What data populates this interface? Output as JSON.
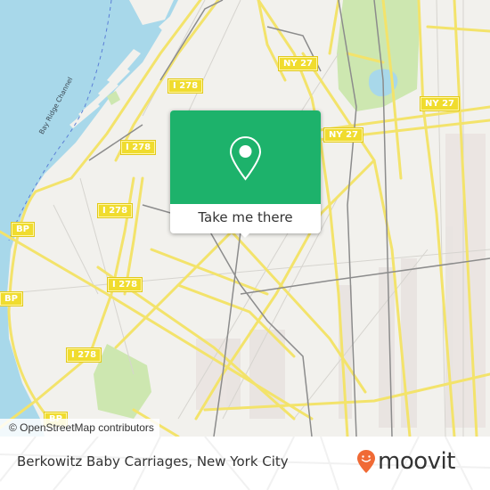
{
  "map": {
    "water_label": "Bay Ridge Channel",
    "road_shields": [
      {
        "label": "I 278",
        "route": "interstate"
      },
      {
        "label": "I 278",
        "route": "interstate"
      },
      {
        "label": "I 278",
        "route": "interstate"
      },
      {
        "label": "I 278",
        "route": "interstate"
      },
      {
        "label": "I 278",
        "route": "interstate"
      },
      {
        "label": "NY 27",
        "route": "state"
      },
      {
        "label": "NY 27",
        "route": "state"
      },
      {
        "label": "NY 27",
        "route": "state"
      },
      {
        "label": "BP",
        "route": "parkway"
      },
      {
        "label": "BP",
        "route": "parkway"
      },
      {
        "label": "BP",
        "route": "parkway"
      }
    ],
    "attribution": "© OpenStreetMap contributors",
    "colors": {
      "land": "#f2f1ed",
      "water": "#a8d8ea",
      "park": "#cde7b0",
      "major_road": "#f3e36b",
      "rail": "#8c8c8c",
      "industrial": "#e6dfdc"
    }
  },
  "popup": {
    "icon": "location-pin-icon",
    "button_label": "Take me there",
    "accent_color": "#1db26b"
  },
  "footer": {
    "place_name": "Berkowitz Baby Carriages, New York City",
    "brand": "moovit",
    "brand_color": "#f06a35"
  }
}
